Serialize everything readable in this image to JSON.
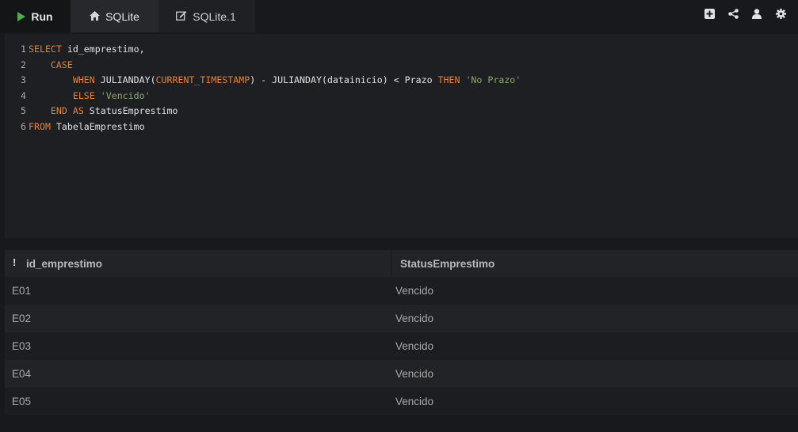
{
  "tabs": [
    {
      "label": "Run",
      "icon": "play-icon"
    },
    {
      "label": "SQLite",
      "icon": "home-icon"
    },
    {
      "label": "SQLite.1",
      "icon": "edit-icon"
    }
  ],
  "toolbar_icons": [
    "add-square-icon",
    "share-icon",
    "user-icon",
    "gear-icon"
  ],
  "colors": {
    "run": "#4caf50",
    "keyword": "#e7822f",
    "string": "#8aa86a"
  },
  "editor": {
    "lines": [
      {
        "n": "1",
        "tokens": [
          {
            "t": "SELECT",
            "c": "kw"
          },
          {
            "t": " id_emprestimo,",
            "c": "id"
          }
        ]
      },
      {
        "n": "2",
        "tokens": [
          {
            "t": "    ",
            "c": "id"
          },
          {
            "t": "CASE",
            "c": "kw"
          }
        ]
      },
      {
        "n": "3",
        "tokens": [
          {
            "t": "        ",
            "c": "id"
          },
          {
            "t": "WHEN",
            "c": "kw"
          },
          {
            "t": " JULIANDAY(",
            "c": "id"
          },
          {
            "t": "CURRENT_TIMESTAMP",
            "c": "kw"
          },
          {
            "t": ") - JULIANDAY(datainicio) < Prazo ",
            "c": "id"
          },
          {
            "t": "THEN",
            "c": "kw"
          },
          {
            "t": " ",
            "c": "id"
          },
          {
            "t": "'No Prazo'",
            "c": "str"
          }
        ]
      },
      {
        "n": "4",
        "tokens": [
          {
            "t": "        ",
            "c": "id"
          },
          {
            "t": "ELSE",
            "c": "kw"
          },
          {
            "t": " ",
            "c": "id"
          },
          {
            "t": "'Vencido'",
            "c": "str"
          }
        ]
      },
      {
        "n": "5",
        "tokens": [
          {
            "t": "    ",
            "c": "id"
          },
          {
            "t": "END",
            "c": "kw"
          },
          {
            "t": " ",
            "c": "id"
          },
          {
            "t": "AS",
            "c": "kw"
          },
          {
            "t": " StatusEmprestimo",
            "c": "id"
          }
        ]
      },
      {
        "n": "6",
        "tokens": [
          {
            "t": "FROM",
            "c": "kw"
          },
          {
            "t": " TabelaEmprestimo",
            "c": "id"
          }
        ]
      }
    ]
  },
  "results": {
    "columns": [
      "id_emprestimo",
      "StatusEmprestimo"
    ],
    "header_marker": "!",
    "rows": [
      [
        "E01",
        "Vencido"
      ],
      [
        "E02",
        "Vencido"
      ],
      [
        "E03",
        "Vencido"
      ],
      [
        "E04",
        "Vencido"
      ],
      [
        "E05",
        "Vencido"
      ]
    ]
  }
}
